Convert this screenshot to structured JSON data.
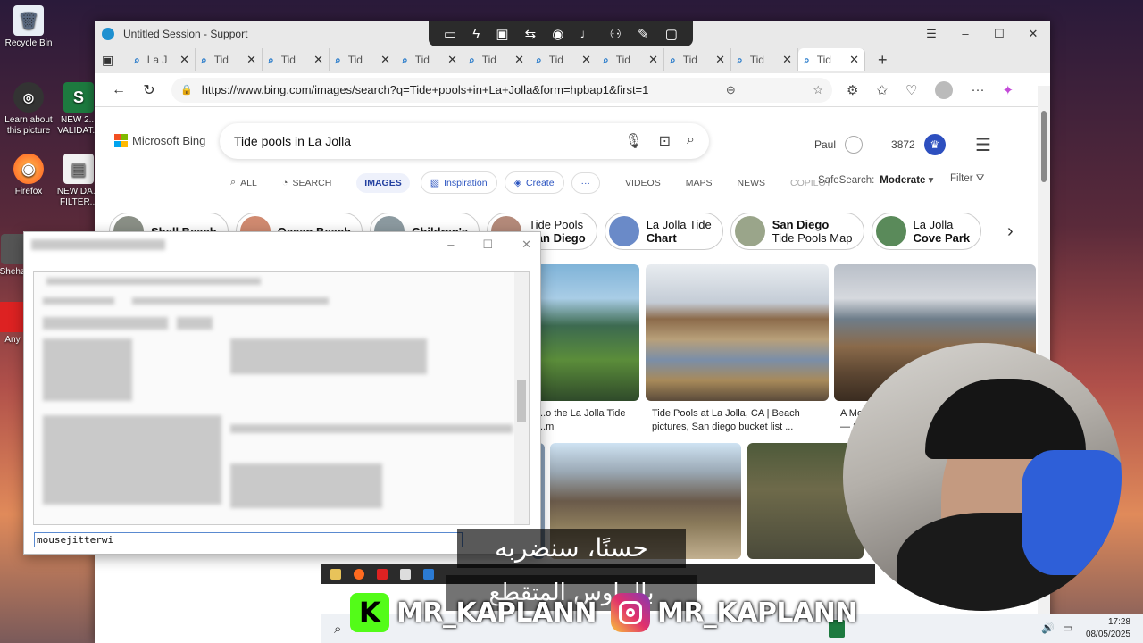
{
  "desktop": {
    "icons": [
      {
        "label": "Recycle Bin",
        "glyph": "🗑"
      },
      {
        "label": "Learn about this picture",
        "glyph": "⬤"
      },
      {
        "label": "Firefox",
        "glyph": "🦊"
      },
      {
        "label": "NEW 2... VALIDAT...",
        "glyph": "S"
      },
      {
        "label": "NEW DA... FILTER...",
        "glyph": "▤"
      },
      {
        "label": "Shehz...",
        "glyph": ""
      },
      {
        "label": "Any",
        "glyph": ""
      }
    ]
  },
  "window": {
    "title": "Untitled Session - Support",
    "controls": {
      "minimize": "–",
      "maximize": "☐",
      "close": "✕"
    }
  },
  "tabs": [
    {
      "label": "La J",
      "active": false
    },
    {
      "label": "Tid",
      "active": false
    },
    {
      "label": "Tid",
      "active": false
    },
    {
      "label": "Tid",
      "active": false
    },
    {
      "label": "Tid",
      "active": false
    },
    {
      "label": "Tid",
      "active": false
    },
    {
      "label": "Tid",
      "active": false
    },
    {
      "label": "Tid",
      "active": false
    },
    {
      "label": "Tid",
      "active": false
    },
    {
      "label": "Tid",
      "active": false
    },
    {
      "label": "Tid",
      "active": true
    }
  ],
  "address": {
    "url": "https://www.bing.com/images/search?q=Tide+pools+in+La+Jolla&form=hpbap1&first=1"
  },
  "bing": {
    "logo_text": "Microsoft Bing",
    "query": "Tide pools in La Jolla",
    "user_name": "Paul",
    "points": "3872",
    "nav": {
      "all": "ALL",
      "search": "SEARCH",
      "images": "IMAGES",
      "inspiration": "Inspiration",
      "create": "Create",
      "more": "···",
      "videos": "VIDEOS",
      "maps": "MAPS",
      "news": "NEWS",
      "copilot": "COPILOT"
    },
    "safesearch_label": "SafeSearch:",
    "safesearch_value": "Moderate",
    "filter_label": "Filter",
    "chips": [
      {
        "line1": "Shell Beach",
        "line2": "",
        "color": "#8a8f86"
      },
      {
        "line1": "Ocean Beach",
        "line2": "",
        "color": "#d08a70"
      },
      {
        "line1": "Children's",
        "line2": "",
        "color": "#8c9aa0"
      },
      {
        "line1": "Tide Pools",
        "line2": "San Diego",
        "color": "#b48a7a"
      },
      {
        "line1": "La Jolla Tide",
        "line2": "Chart",
        "color": "#6a8ac8"
      },
      {
        "line1": "San Diego",
        "line2": "Tide Pools Map",
        "color": "#9aa58a"
      },
      {
        "line1": "La Jolla",
        "line2": "Cove Park",
        "color": "#5a8a5a"
      }
    ],
    "results": [
      {
        "caption": "...o the La Jolla Tide ...m"
      },
      {
        "caption": "Tide Pools at La Jolla, CA | Beach pictures, San diego bucket list ..."
      },
      {
        "caption": "A Mo... — S..."
      }
    ]
  },
  "dialog": {
    "input_value": "mousejitterwi"
  },
  "overlay": {
    "subtitle_line1": "حسنًا، سنضربه",
    "subtitle_line2": "بالماوس المتقطع",
    "brand_kick": "MR_KAPLANN",
    "brand_instagram": "MR_KAPLANN"
  },
  "taskbar": {
    "time": "17:28",
    "date": "08/05/2025"
  }
}
